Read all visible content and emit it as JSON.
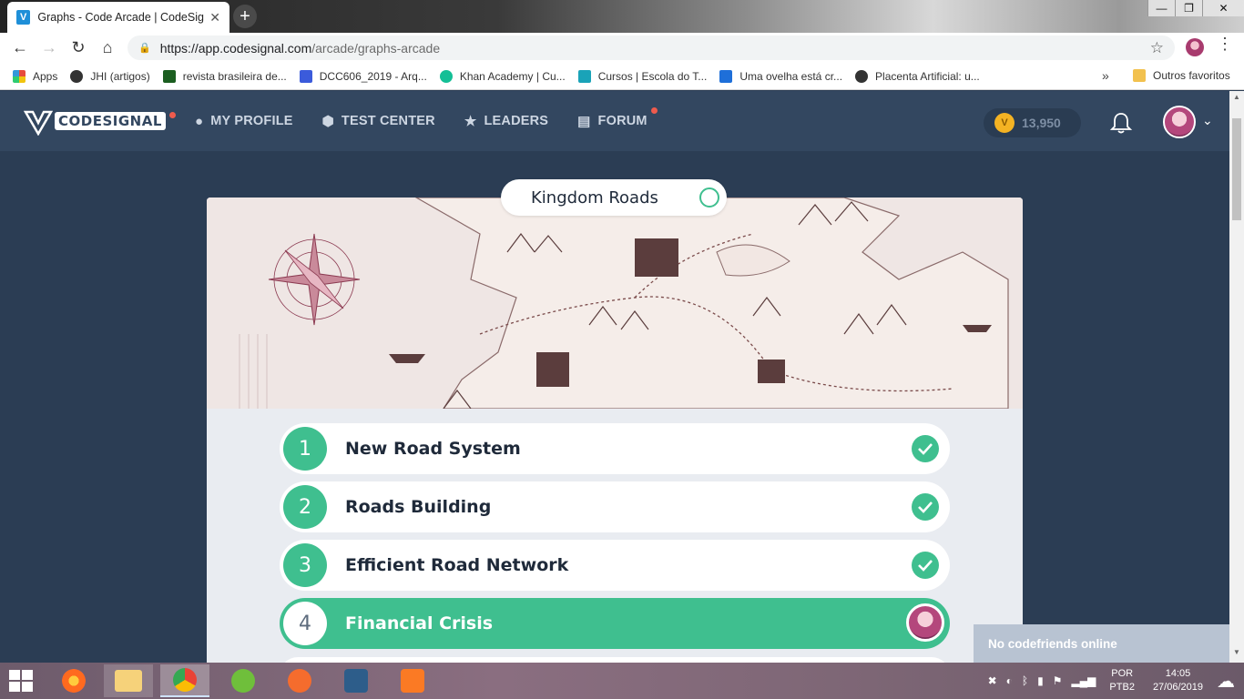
{
  "browser": {
    "tab_title": "Graphs - Code Arcade | CodeSignal",
    "new_tab": "+",
    "window_buttons": [
      "—",
      "❐",
      "✕"
    ],
    "url_host": "https://app.codesignal.com",
    "url_path": "/arcade/graphs-arcade",
    "bookmarks": [
      {
        "label": "Apps",
        "color": "#e74c3c"
      },
      {
        "label": "JHI (artigos)",
        "color": "#ffffff"
      },
      {
        "label": "revista brasileira de...",
        "color": "#2ecc71"
      },
      {
        "label": "DCC606_2019 - Arq...",
        "color": "#3b5bdb"
      },
      {
        "label": "Khan Academy | Cu...",
        "color": "#14bf96"
      },
      {
        "label": "Cursos | Escola do T...",
        "color": "#1aa3b8"
      },
      {
        "label": "Uma ovelha está cr...",
        "color": "#1e6fd9"
      },
      {
        "label": "Placenta Artificial: u...",
        "color": "#ffffff"
      }
    ],
    "bookmarks_more": "»",
    "other_bookmarks": "Outros favoritos"
  },
  "header": {
    "logo_text": "CODESIGNAL",
    "nav": [
      {
        "label": "MY PROFILE",
        "icon": "user-icon"
      },
      {
        "label": "TEST CENTER",
        "icon": "shield-icon"
      },
      {
        "label": "LEADERS",
        "icon": "star-icon"
      },
      {
        "label": "FORUM",
        "icon": "chat-icon"
      }
    ],
    "coins": "13,950"
  },
  "arcade": {
    "title": "Kingdom Roads",
    "levels": [
      {
        "num": "1",
        "name": "New Road System",
        "completed": true
      },
      {
        "num": "2",
        "name": "Roads Building",
        "completed": true
      },
      {
        "num": "3",
        "name": "Efficient Road Network",
        "completed": true
      },
      {
        "num": "4",
        "name": "Financial Crisis",
        "completed": false,
        "active": true
      }
    ]
  },
  "codefriends": "No codefriends online",
  "taskbar": {
    "apps": [
      "firefox",
      "file-explorer",
      "chrome",
      "utorrent",
      "origin",
      "mysql-workbench",
      "xampp"
    ],
    "lang_top": "POR",
    "lang_bottom": "PTB2",
    "time": "14:05",
    "date": "27/06/2019"
  },
  "colors": {
    "accent": "#3fbf8f",
    "header_bg": "#334760",
    "page_bg": "#2b3d54",
    "notify_dot": "#ef5b4d"
  }
}
